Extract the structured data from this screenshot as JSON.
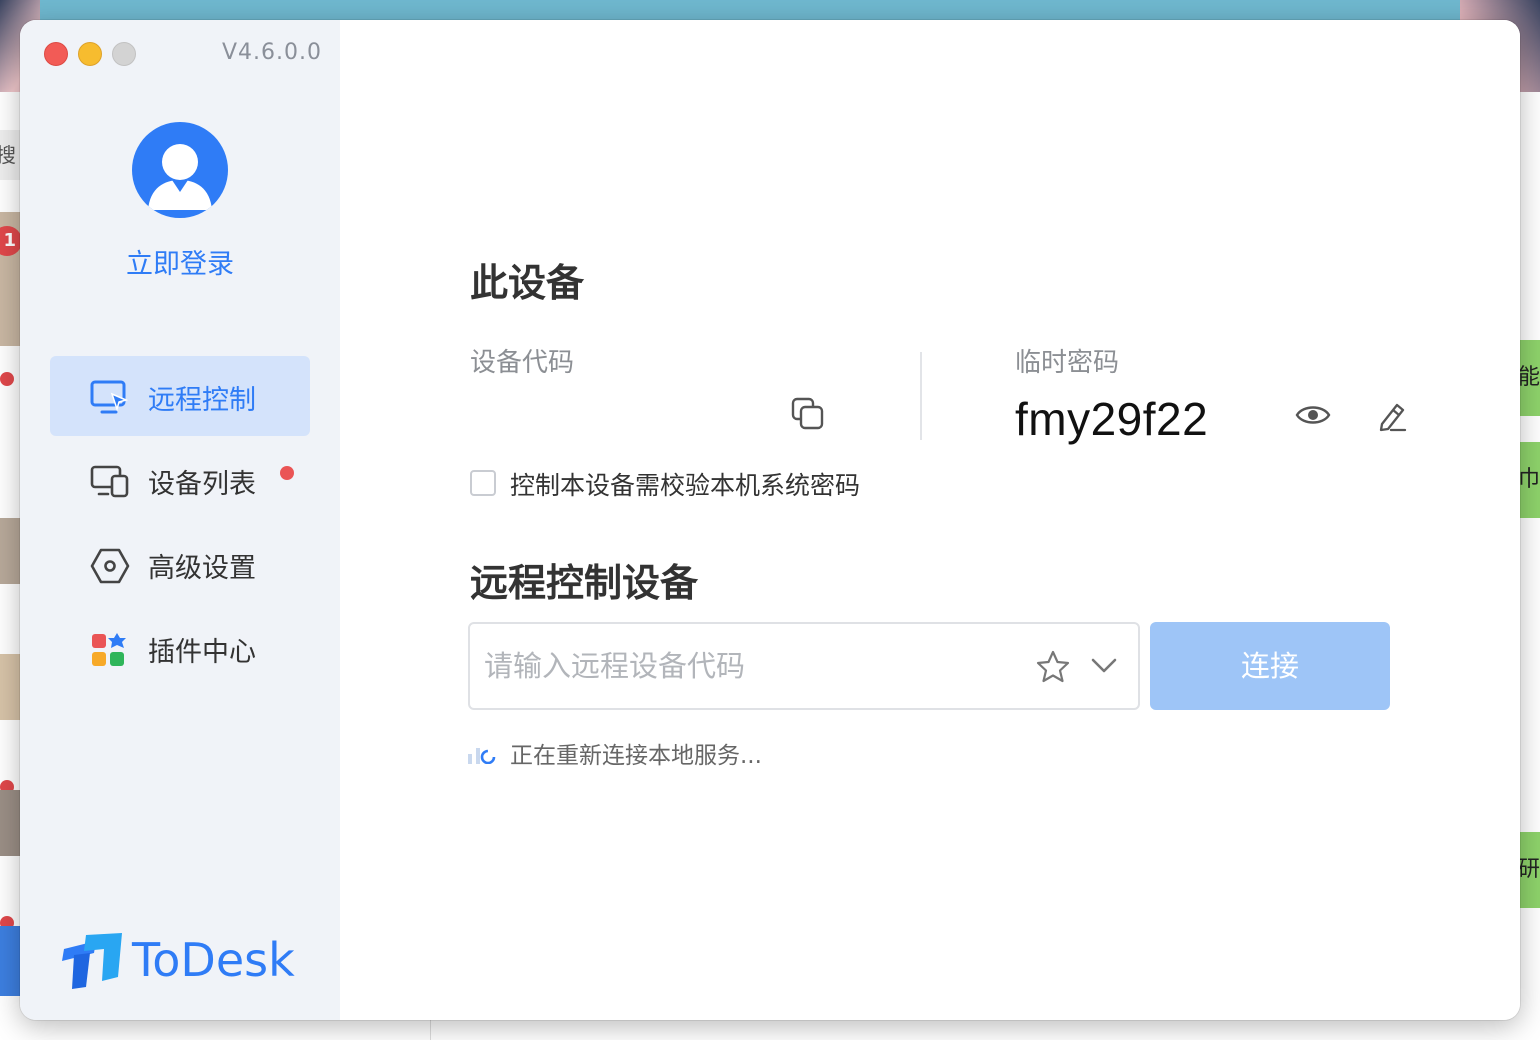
{
  "window": {
    "version": "V4.6.0.0",
    "brand": "ToDesk"
  },
  "sidebar": {
    "login_label": "立即登录",
    "items": [
      {
        "label": "远程控制",
        "icon": "monitor-remote-icon",
        "active": true
      },
      {
        "label": "设备列表",
        "icon": "devices-icon",
        "badge": true
      },
      {
        "label": "高级设置",
        "icon": "settings-hexagon-icon"
      },
      {
        "label": "插件中心",
        "icon": "plugins-grid-icon"
      }
    ]
  },
  "this_device": {
    "title": "此设备",
    "device_code_label": "设备代码",
    "device_code_value": "",
    "temp_password_label": "临时密码",
    "temp_password_value": "fmy29f22",
    "verify_system_password_label": "控制本设备需校验本机系统密码",
    "verify_system_password_checked": false
  },
  "remote_control": {
    "title": "远程控制设备",
    "input_placeholder": "请输入远程设备代码",
    "input_value": "",
    "connect_label": "连接",
    "status_text": "正在重新连接本地服务..."
  },
  "background": {
    "search_hint": "搜索",
    "badge_count": "1",
    "right_chars": [
      "能",
      "巾",
      "研"
    ]
  },
  "colors": {
    "accent": "#2f7cf6",
    "sidebar_bg": "#f0f3f8",
    "active_item_bg": "#d4e3fb",
    "connect_disabled": "#9ec5f7",
    "badge": "#ea5455"
  }
}
